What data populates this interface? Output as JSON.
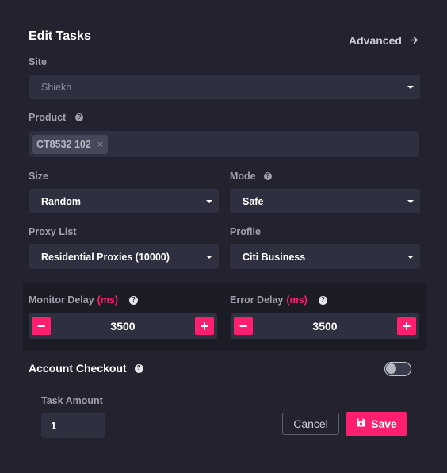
{
  "header": {
    "title": "Edit Tasks",
    "advanced_label": "Advanced",
    "advanced_icon": "arrow-right-icon"
  },
  "site": {
    "label": "Site",
    "value": "Shiekh"
  },
  "product": {
    "label": "Product",
    "help_icon": "question-circle-icon",
    "chips": [
      "CT8532 102"
    ],
    "chip_remove": "×"
  },
  "size": {
    "label": "Size",
    "value": "Random"
  },
  "mode": {
    "label": "Mode",
    "help_icon": "question-circle-icon",
    "value": "Safe"
  },
  "proxy_list": {
    "label": "Proxy List",
    "value": "Residential Proxies (10000)"
  },
  "profile": {
    "label": "Profile",
    "value": "Citi Business"
  },
  "monitor_delay": {
    "label": "Monitor Delay",
    "unit": "(ms)",
    "value": "3500",
    "minus": "−",
    "plus": "+"
  },
  "error_delay": {
    "label": "Error Delay",
    "unit": "(ms)",
    "value": "3500",
    "minus": "−",
    "plus": "+"
  },
  "account_checkout": {
    "label": "Account Checkout",
    "enabled": false
  },
  "task_amount": {
    "label": "Task Amount",
    "value": "1"
  },
  "footer": {
    "cancel_label": "Cancel",
    "save_label": "Save",
    "save_icon": "floppy-disk-icon"
  },
  "colors": {
    "background": "#22232f",
    "field": "#2e3040",
    "accent": "#ff1f6e",
    "muted_text": "#9ea0ab"
  }
}
